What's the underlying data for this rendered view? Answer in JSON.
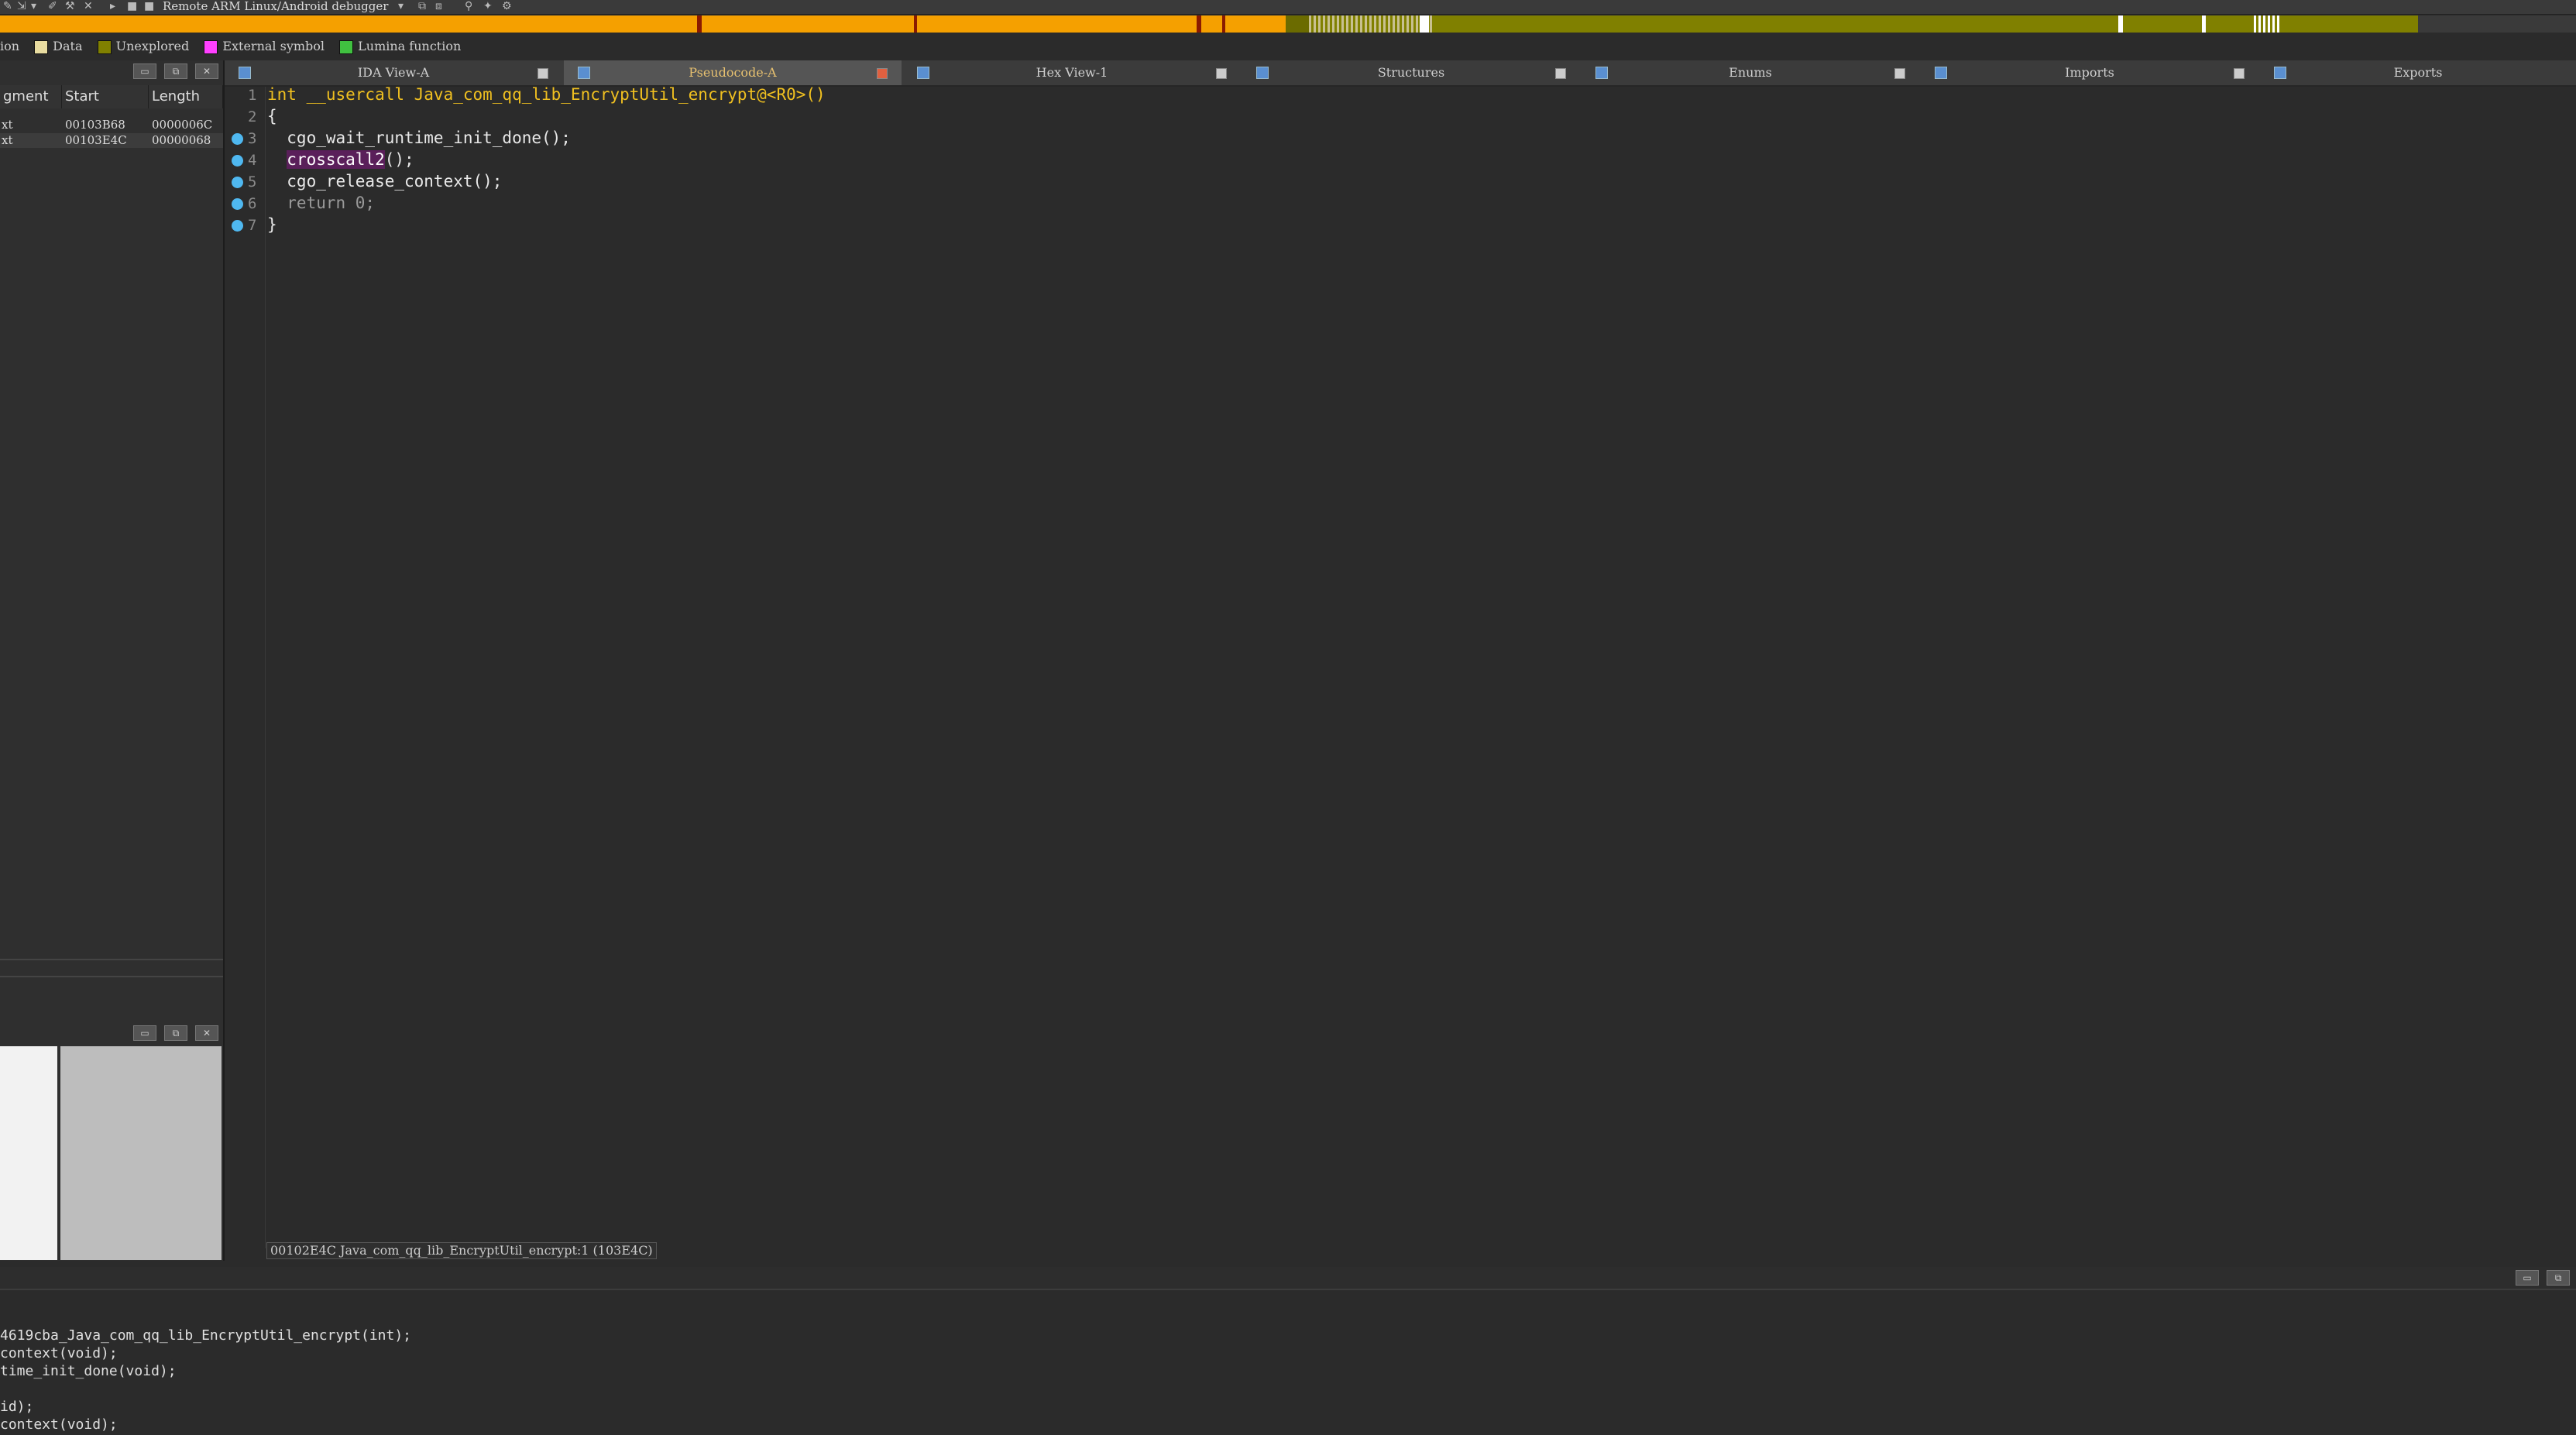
{
  "toolbar": {
    "debugger_label": "Remote ARM Linux/Android debugger"
  },
  "legend": {
    "items": [
      {
        "label": "ion",
        "color": ""
      },
      {
        "label": "Data",
        "color": "#e8dca0"
      },
      {
        "label": "Unexplored",
        "color": "#808000"
      },
      {
        "label": "External symbol",
        "color": "#ff40ff"
      },
      {
        "label": "Lumina function",
        "color": "#40c040"
      }
    ]
  },
  "colors": {
    "nav_code": "#f5a000",
    "nav_unexplored": "#808000",
    "nav_data": "#c8b400",
    "breakpoint": "#4fb8f0",
    "highlight": "#5a1f5a"
  },
  "segments": {
    "columns": [
      "gment",
      "Start",
      "Length"
    ],
    "rows": [
      {
        "name": "xt",
        "start": "00103B68",
        "length": "0000006C"
      },
      {
        "name": "xt",
        "start": "00103E4C",
        "length": "00000068"
      }
    ]
  },
  "tabs": [
    {
      "label": "IDA View-A",
      "icon": "ida-view-icon",
      "active": false
    },
    {
      "label": "Pseudocode-A",
      "icon": "pseudocode-icon",
      "active": true
    },
    {
      "label": "Hex View-1",
      "icon": "hex-view-icon",
      "active": false
    },
    {
      "label": "Structures",
      "icon": "structures-icon",
      "active": false
    },
    {
      "label": "Enums",
      "icon": "enums-icon",
      "active": false
    },
    {
      "label": "Imports",
      "icon": "imports-icon",
      "active": false
    },
    {
      "label": "Exports",
      "icon": "exports-icon",
      "active": false
    }
  ],
  "code": {
    "lines": [
      {
        "num": "1",
        "text": "int __usercall Java_com_qq_lib_EncryptUtil_encrypt@<R0>()",
        "bp": false
      },
      {
        "num": "2",
        "text": "{",
        "bp": false
      },
      {
        "num": "3",
        "text": "  cgo_wait_runtime_init_done();",
        "bp": true
      },
      {
        "num": "4",
        "text": "crosscall2",
        "suffix": "();",
        "bp": true
      },
      {
        "num": "5",
        "text": "  cgo_release_context();",
        "bp": true
      },
      {
        "num": "6",
        "text": "  return 0;",
        "bp": true
      },
      {
        "num": "7",
        "text": "}",
        "bp": true
      }
    ]
  },
  "status": {
    "text": "00102E4C Java_com_qq_lib_EncryptUtil_encrypt:1 (103E4C)"
  },
  "output": {
    "lines": [
      "4619cba_Java_com_qq_lib_EncryptUtil_encrypt(int);",
      "context(void);",
      "time_init_done(void);",
      "",
      "id);",
      "context(void);"
    ]
  }
}
